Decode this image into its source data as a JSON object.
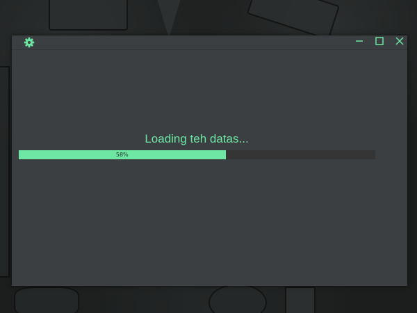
{
  "window": {
    "title": "",
    "icons": {
      "settings": "gear-icon",
      "minimize": "minimize-icon",
      "maximize": "maximize-icon",
      "close": "close-icon"
    }
  },
  "loading": {
    "message": "Loading teh datas...",
    "progress_percent": 58,
    "progress_label": "58%"
  },
  "colors": {
    "accent": "#6ee6a4",
    "window_bg": "#3c3f41",
    "track_bg": "#353535"
  }
}
